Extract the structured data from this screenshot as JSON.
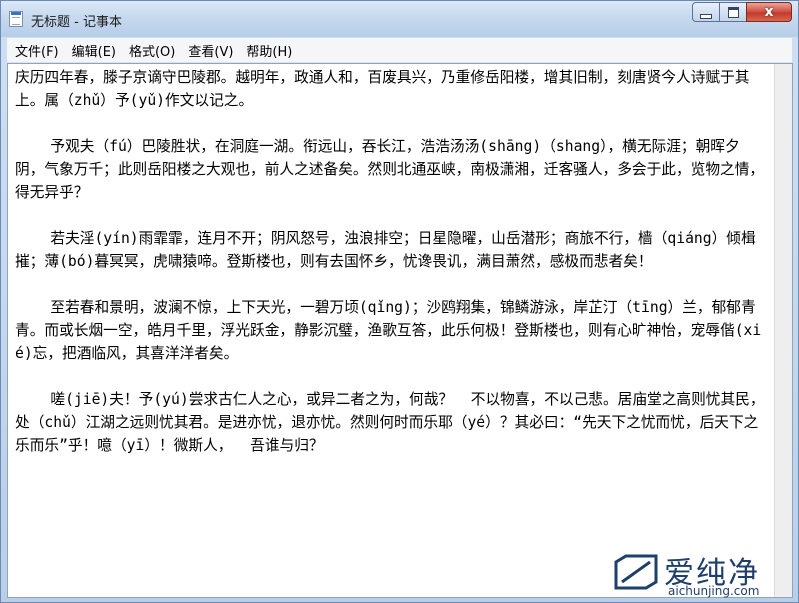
{
  "window": {
    "title": "无标题 - 记事本",
    "close_glyph": "x"
  },
  "menu": {
    "items": [
      {
        "label": "文件(F)"
      },
      {
        "label": "编辑(E)"
      },
      {
        "label": "格式(O)"
      },
      {
        "label": "查看(V)"
      },
      {
        "label": "帮助(H)"
      }
    ]
  },
  "document": {
    "text": "庆历四年春，滕子京谪守巴陵郡。越明年，政通人和，百废具兴，乃重修岳阳楼，增其旧制，刻唐贤今人诗赋于其上。属（zhǔ）予(yǔ)作文以记之。\n\n    予观夫（fú）巴陵胜状，在洞庭一湖。衔远山，吞长江，浩浩汤汤(shāng)（shang），横无际涯；朝晖夕阴，气象万千；此则岳阳楼之大观也，前人之述备矣。然则北通巫峡，南极潇湘，迁客骚人，多会于此，览物之情，得无异乎？\n\n    若夫淫(yín)雨霏霏，连月不开；阴风怒号，浊浪排空；日星隐曜，山岳潜形；商旅不行，樯（qiáng）倾楫摧；薄(bó)暮冥冥，虎啸猿啼。登斯楼也，则有去国怀乡，忧谗畏讥，满目萧然，感极而悲者矣！\n\n    至若春和景明，波澜不惊，上下天光，一碧万顷(qǐng)；沙鸥翔集，锦鳞游泳，岸芷汀（tīng）兰，郁郁青青。而或长烟一空，皓月千里，浮光跃金，静影沉璧，渔歌互答，此乐何极！登斯楼也，则有心旷神怡，宠辱偕(xié)忘，把酒临风，其喜洋洋者矣。\n\n    嗟(jiē)夫！予(yú)尝求古仁人之心，或异二者之为，何哉？  不以物喜，不以己悲。居庙堂之高则忧其民，处（chǔ）江湖之远则忧其君。是进亦忧，退亦忧。然则何时而乐耶（yé）？其必曰：“先天下之忧而忧，后天下之乐而乐”乎！噫（yī）！微斯人，  吾谁与归？"
  },
  "watermark": {
    "brand": "爱纯净",
    "url": "aichunjing.com",
    "color": "#1f3f6b"
  }
}
